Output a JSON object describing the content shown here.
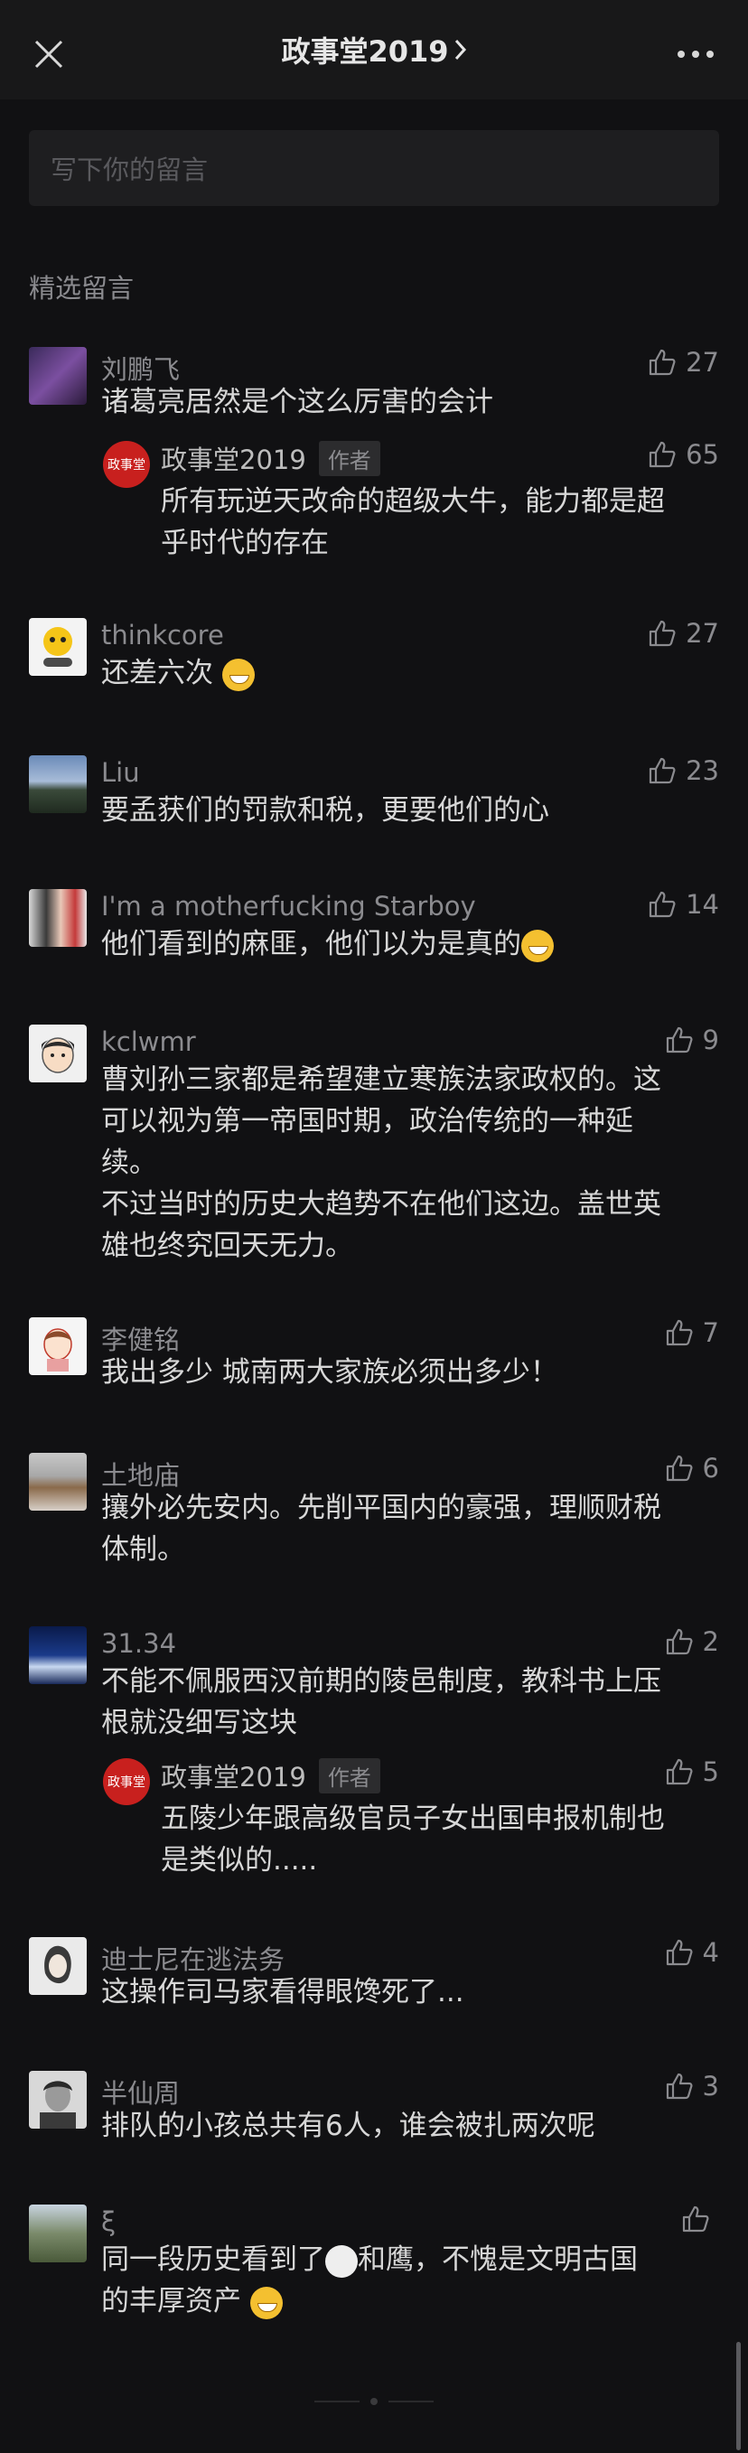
{
  "header": {
    "title": "政事堂2019",
    "close_icon": "close-icon",
    "more_icon": "more-dots-icon"
  },
  "input": {
    "placeholder": "写下你的留言"
  },
  "section_label": "精选留言",
  "comments": [
    {
      "name": "刘鹏飞",
      "text": "诸葛亮居然是个这么厉害的会计",
      "likes": "27"
    },
    {
      "name": "thinkcore",
      "text": "还差六次",
      "likes": "27"
    },
    {
      "name": "Liu",
      "text": "要孟获们的罚款和税，更要他们的心",
      "likes": "23"
    },
    {
      "name": "I'm a motherfucking Starboy",
      "text": "他们看到的麻匪，他们以为是真的",
      "likes": "14"
    },
    {
      "name": "kclwmr",
      "text_lines": [
        "曹刘孙三家都是希望建立寒族法家政权的。这",
        "可以视为第一帝国时期，政治传统的一种延",
        "续。",
        "不过当时的历史大趋势不在他们这边。盖世英",
        "雄也终究回天无力。"
      ],
      "likes": "9"
    },
    {
      "name": "李健铭",
      "text": "我出多少 城南两大家族必须出多少！",
      "likes": "7"
    },
    {
      "name": "土地庙",
      "text_lines": [
        "攘外必先安内。先削平国内的豪强，理顺财税",
        "体制。"
      ],
      "likes": "6"
    },
    {
      "name": "31.34",
      "text_lines": [
        "不能不佩服西汉前期的陵邑制度，教科书上压",
        "根就没细写这块"
      ],
      "likes": "2"
    },
    {
      "name": "迪士尼在逃法务",
      "text": "这操作司马家看得眼馋死了...",
      "likes": "4"
    },
    {
      "name": "半仙周",
      "text": "排队的小孩总共有6人，谁会被扎两次呢",
      "likes": "3"
    },
    {
      "name": "ξ",
      "text_lines": [
        "同一段历史看到了",
        "的丰厚资产"
      ],
      "text_mid": "和鹰，不愧是文明古国",
      "likes": ""
    }
  ],
  "replies": [
    {
      "name": "政事堂2019",
      "tag": "作者",
      "logo": "政事堂",
      "text_lines": [
        "所有玩逆天改命的超级大牛，能力都是超",
        "乎时代的存在"
      ],
      "likes": "65"
    },
    {
      "name": "政事堂2019",
      "tag": "作者",
      "logo": "政事堂",
      "text_lines": [
        "五陵少年跟高级官员子女出国申报机制也",
        "是类似的....."
      ],
      "likes": "5"
    }
  ],
  "colors": {
    "background": "#111113",
    "header": "#181819",
    "input": "#1e1e20",
    "muted": "#8b8b8f",
    "text": "#d7d7d7",
    "author_logo": "#c8201e"
  }
}
